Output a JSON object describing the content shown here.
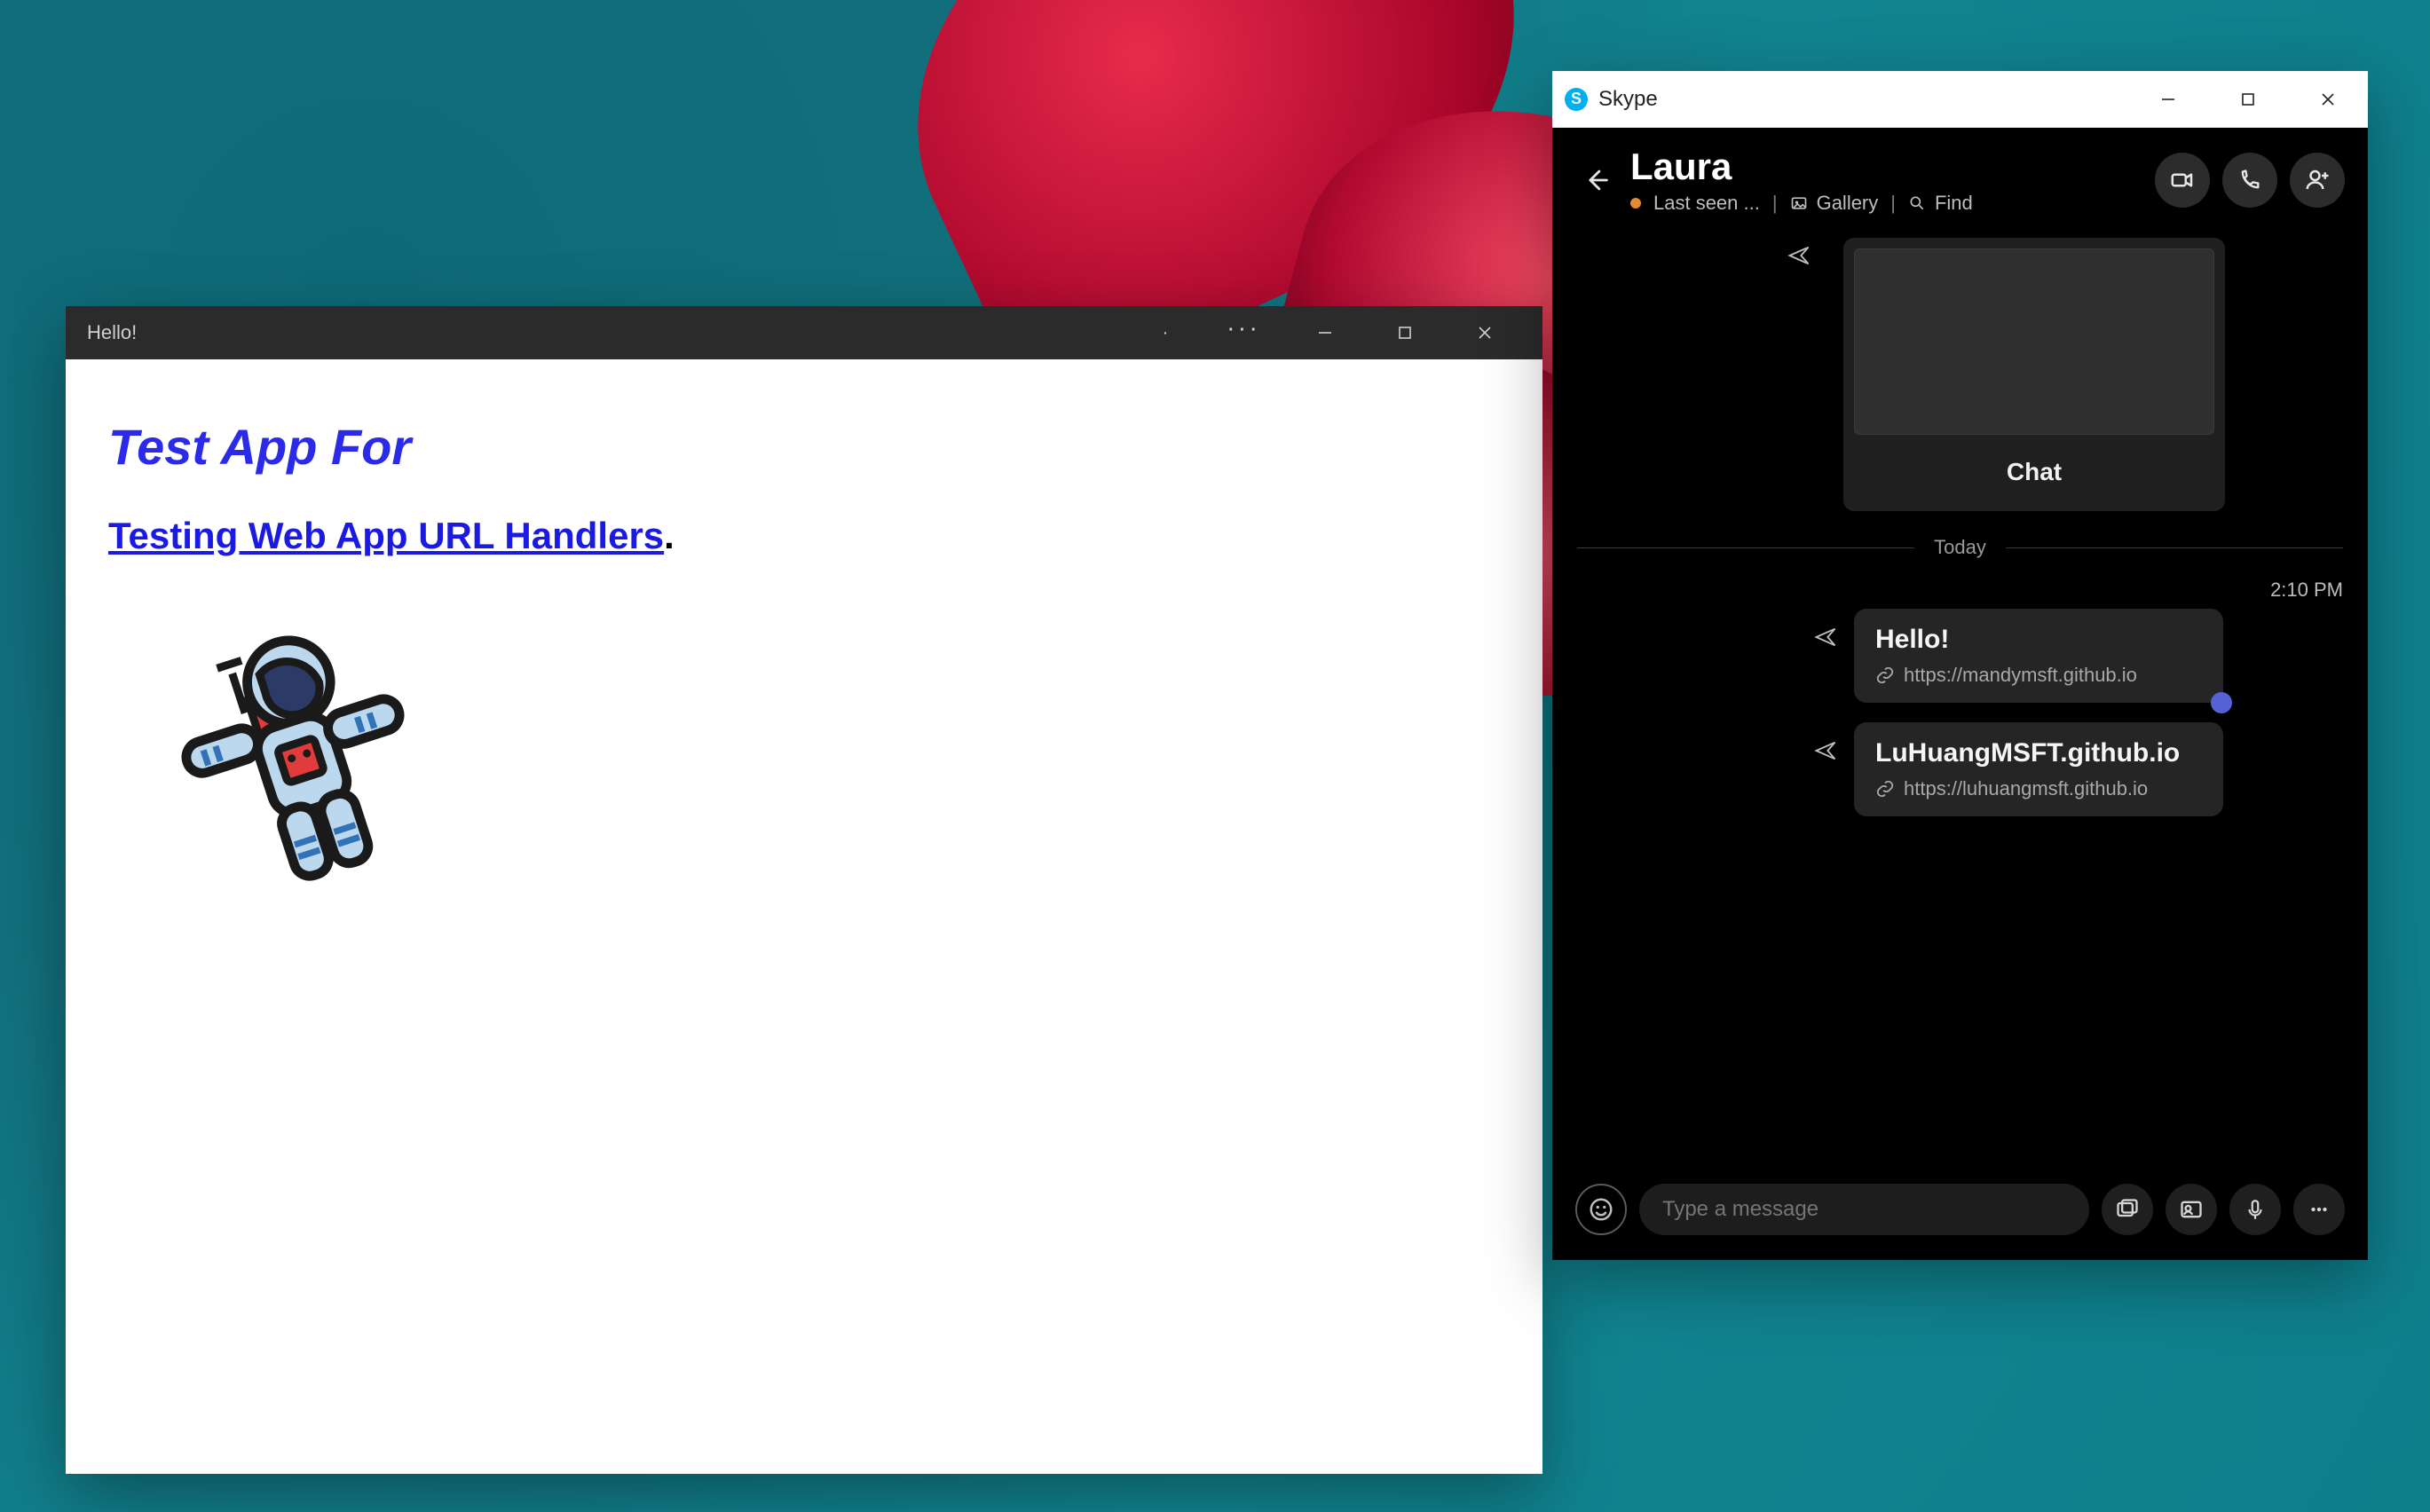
{
  "helloWindow": {
    "title": "Hello!",
    "heading": "Test App For",
    "linkText": "Testing Web App URL Handlers",
    "period": "."
  },
  "skype": {
    "appName": "Skype",
    "header": {
      "contactName": "Laura",
      "lastSeen": "Last seen ...",
      "gallery": "Gallery",
      "find": "Find"
    },
    "previewChatLabel": "Chat",
    "dateDivider": "Today",
    "timestamp": "2:10 PM",
    "messages": [
      {
        "title": "Hello!",
        "url": "https://mandymsft.github.io",
        "hasBadge": true
      },
      {
        "title": "LuHuangMSFT.github.io",
        "url": "https://luhuangmsft.github.io",
        "hasBadge": false
      }
    ],
    "composer": {
      "placeholder": "Type a message"
    }
  }
}
